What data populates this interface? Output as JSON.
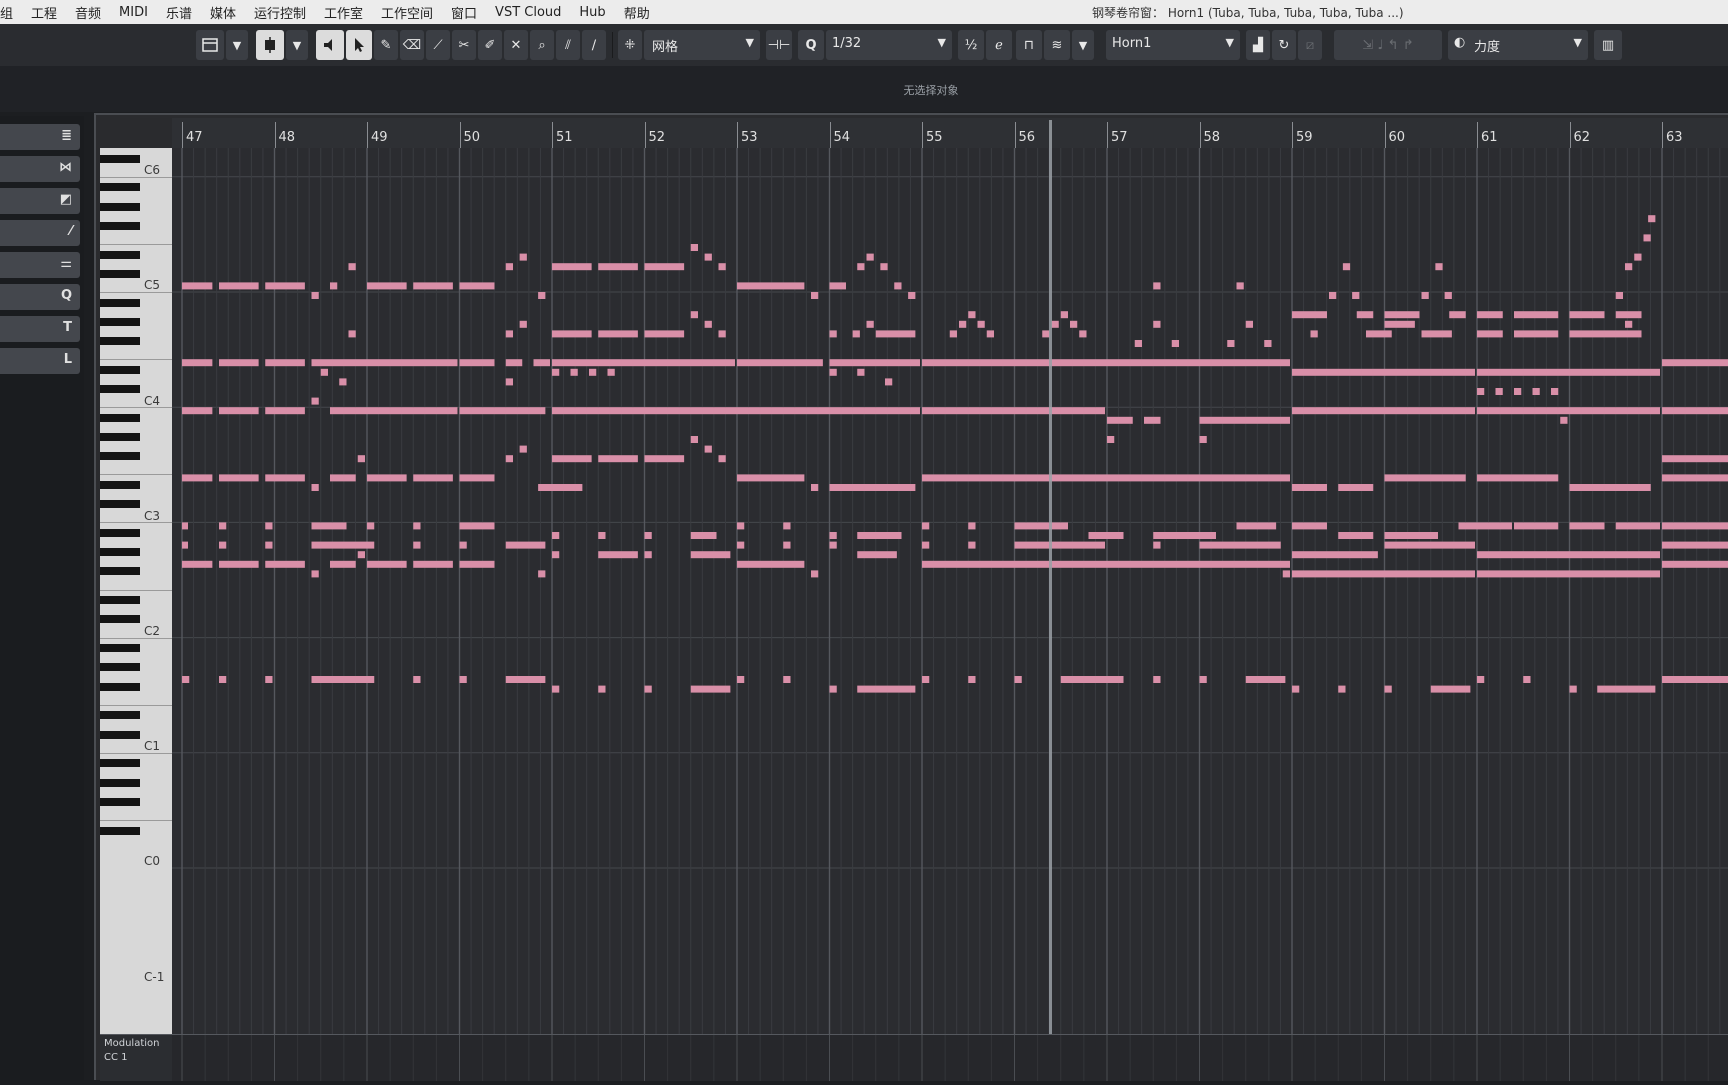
{
  "menu": [
    "组",
    "工程",
    "音频",
    "MIDI",
    "乐谱",
    "媒体",
    "运行控制",
    "工作室",
    "工作空间",
    "窗口",
    "VST Cloud",
    "Hub",
    "帮助"
  ],
  "window_title": "钢琴卷帘窗： Horn1 (Tuba, Tuba, Tuba, Tuba, Tuba ...)",
  "toolbar": {
    "snap_type": "网格",
    "quantize": "1/32",
    "track": "Horn1",
    "controller": "力度"
  },
  "status_text": "无选择对象",
  "ruler": {
    "bars": [
      "47",
      "48",
      "49",
      "50",
      "51",
      "52",
      "53",
      "54",
      "55",
      "56",
      "57",
      "58",
      "59",
      "60",
      "61",
      "62",
      "63"
    ]
  },
  "keyboard": {
    "octave_labels": [
      "C6",
      "C5",
      "C4",
      "C3",
      "C2",
      "C1",
      "C0",
      "C-1"
    ]
  },
  "inspector": {
    "buttons": [
      "≣",
      "⋈",
      "◩",
      "⁄",
      "⚌",
      "Q",
      "T",
      "L"
    ]
  },
  "lane": {
    "name": "Modulation",
    "cc": "CC 1"
  },
  "colors": {
    "note": "#d98fa8",
    "background": "#2b2c30",
    "grid_bar": "#55585e",
    "grid_beat": "#3a3c40"
  },
  "notes": [
    {
      "bar": 47.0,
      "len": 0.35,
      "pitch": 72
    },
    {
      "bar": 47.4,
      "len": 0.45,
      "pitch": 72
    },
    {
      "bar": 47.9,
      "len": 0.45,
      "pitch": 72
    },
    {
      "bar": 48.4,
      "len": 0.1,
      "pitch": 71
    },
    {
      "bar": 48.6,
      "len": 0.1,
      "pitch": 72
    },
    {
      "bar": 48.8,
      "len": 0.1,
      "pitch": 74
    },
    {
      "bar": 49.0,
      "len": 0.45,
      "pitch": 72
    },
    {
      "bar": 49.5,
      "len": 0.45,
      "pitch": 72
    },
    {
      "bar": 50.0,
      "len": 0.4,
      "pitch": 72
    },
    {
      "bar": 50.5,
      "len": 0.1,
      "pitch": 74
    },
    {
      "bar": 50.65,
      "len": 0.1,
      "pitch": 75
    },
    {
      "bar": 50.85,
      "len": 0.1,
      "pitch": 71
    },
    {
      "bar": 51.0,
      "len": 0.45,
      "pitch": 74
    },
    {
      "bar": 51.5,
      "len": 0.45,
      "pitch": 74
    },
    {
      "bar": 52.0,
      "len": 0.45,
      "pitch": 74
    },
    {
      "bar": 52.5,
      "len": 0.1,
      "pitch": 76
    },
    {
      "bar": 52.65,
      "len": 0.1,
      "pitch": 75
    },
    {
      "bar": 52.8,
      "len": 0.1,
      "pitch": 74
    },
    {
      "bar": 53.0,
      "len": 0.75,
      "pitch": 72
    },
    {
      "bar": 53.8,
      "len": 0.1,
      "pitch": 71
    },
    {
      "bar": 54.0,
      "len": 0.2,
      "pitch": 72
    },
    {
      "bar": 54.3,
      "len": 0.1,
      "pitch": 74
    },
    {
      "bar": 54.4,
      "len": 0.1,
      "pitch": 75
    },
    {
      "bar": 54.55,
      "len": 0.1,
      "pitch": 74
    },
    {
      "bar": 54.7,
      "len": 0.1,
      "pitch": 72
    },
    {
      "bar": 54.85,
      "len": 0.1,
      "pitch": 71
    },
    {
      "bar": 57.5,
      "len": 0.1,
      "pitch": 72
    },
    {
      "bar": 58.4,
      "len": 0.1,
      "pitch": 72
    },
    {
      "bar": 59.4,
      "len": 0.1,
      "pitch": 71
    },
    {
      "bar": 59.55,
      "len": 0.1,
      "pitch": 74
    },
    {
      "bar": 59.65,
      "len": 0.1,
      "pitch": 71
    },
    {
      "bar": 60.4,
      "len": 0.1,
      "pitch": 71
    },
    {
      "bar": 60.55,
      "len": 0.1,
      "pitch": 74
    },
    {
      "bar": 60.65,
      "len": 0.1,
      "pitch": 71
    },
    {
      "bar": 62.5,
      "len": 0.1,
      "pitch": 71
    },
    {
      "bar": 62.6,
      "len": 0.1,
      "pitch": 74
    },
    {
      "bar": 62.7,
      "len": 0.1,
      "pitch": 75
    },
    {
      "bar": 62.8,
      "len": 0.1,
      "pitch": 77
    },
    {
      "bar": 62.85,
      "len": 0.1,
      "pitch": 79
    },
    {
      "bar": 55.3,
      "len": 0.1,
      "pitch": 67
    },
    {
      "bar": 55.4,
      "len": 0.1,
      "pitch": 68
    },
    {
      "bar": 55.5,
      "len": 0.1,
      "pitch": 69
    },
    {
      "bar": 55.6,
      "len": 0.1,
      "pitch": 68
    },
    {
      "bar": 55.7,
      "len": 0.1,
      "pitch": 67
    },
    {
      "bar": 56.3,
      "len": 0.1,
      "pitch": 67
    },
    {
      "bar": 56.4,
      "len": 0.1,
      "pitch": 68
    },
    {
      "bar": 56.5,
      "len": 0.1,
      "pitch": 69
    },
    {
      "bar": 56.6,
      "len": 0.1,
      "pitch": 68
    },
    {
      "bar": 56.7,
      "len": 0.1,
      "pitch": 67
    },
    {
      "bar": 57.3,
      "len": 0.1,
      "pitch": 66
    },
    {
      "bar": 57.5,
      "len": 0.1,
      "pitch": 68
    },
    {
      "bar": 57.7,
      "len": 0.1,
      "pitch": 66
    },
    {
      "bar": 58.3,
      "len": 0.1,
      "pitch": 66
    },
    {
      "bar": 58.5,
      "len": 0.1,
      "pitch": 68
    },
    {
      "bar": 58.7,
      "len": 0.1,
      "pitch": 66
    },
    {
      "bar": 59.0,
      "len": 0.4,
      "pitch": 69
    },
    {
      "bar": 59.7,
      "len": 0.2,
      "pitch": 69
    },
    {
      "bar": 60.0,
      "len": 0.4,
      "pitch": 69
    },
    {
      "bar": 60.7,
      "len": 0.2,
      "pitch": 69
    },
    {
      "bar": 61.0,
      "len": 0.3,
      "pitch": 69
    },
    {
      "bar": 61.4,
      "len": 0.5,
      "pitch": 69
    },
    {
      "bar": 62.0,
      "len": 0.4,
      "pitch": 69
    },
    {
      "bar": 62.5,
      "len": 0.3,
      "pitch": 69
    },
    {
      "bar": 48.8,
      "len": 0.1,
      "pitch": 67
    },
    {
      "bar": 50.5,
      "len": 0.1,
      "pitch": 67
    },
    {
      "bar": 50.65,
      "len": 0.1,
      "pitch": 68
    },
    {
      "bar": 51.0,
      "len": 0.45,
      "pitch": 67
    },
    {
      "bar": 51.5,
      "len": 0.45,
      "pitch": 67
    },
    {
      "bar": 52.0,
      "len": 0.45,
      "pitch": 67
    },
    {
      "bar": 52.5,
      "len": 0.1,
      "pitch": 69
    },
    {
      "bar": 52.65,
      "len": 0.1,
      "pitch": 68
    },
    {
      "bar": 52.8,
      "len": 0.1,
      "pitch": 67
    },
    {
      "bar": 54.0,
      "len": 0.1,
      "pitch": 67
    },
    {
      "bar": 54.25,
      "len": 0.1,
      "pitch": 67
    },
    {
      "bar": 54.4,
      "len": 0.1,
      "pitch": 68
    },
    {
      "bar": 54.5,
      "len": 0.45,
      "pitch": 67
    },
    {
      "bar": 59.2,
      "len": 0.1,
      "pitch": 67
    },
    {
      "bar": 59.8,
      "len": 0.3,
      "pitch": 67
    },
    {
      "bar": 60.0,
      "len": 0.35,
      "pitch": 68
    },
    {
      "bar": 60.4,
      "len": 0.35,
      "pitch": 67
    },
    {
      "bar": 61.0,
      "len": 0.3,
      "pitch": 67
    },
    {
      "bar": 61.4,
      "len": 0.5,
      "pitch": 67
    },
    {
      "bar": 62.0,
      "len": 0.8,
      "pitch": 67
    },
    {
      "bar": 62.6,
      "len": 0.1,
      "pitch": 68
    },
    {
      "bar": 47.0,
      "len": 0.35,
      "pitch": 64
    },
    {
      "bar": 47.4,
      "len": 0.45,
      "pitch": 64
    },
    {
      "bar": 47.9,
      "len": 0.45,
      "pitch": 64
    },
    {
      "bar": 48.4,
      "len": 1.6,
      "pitch": 64
    },
    {
      "bar": 50.0,
      "len": 0.4,
      "pitch": 64
    },
    {
      "bar": 50.5,
      "len": 0.2,
      "pitch": 64
    },
    {
      "bar": 50.8,
      "len": 0.2,
      "pitch": 64
    },
    {
      "bar": 51.0,
      "len": 2.0,
      "pitch": 64
    },
    {
      "bar": 53.0,
      "len": 0.95,
      "pitch": 64
    },
    {
      "bar": 54.0,
      "len": 1.0,
      "pitch": 64
    },
    {
      "bar": 55.0,
      "len": 4.0,
      "pitch": 64
    },
    {
      "bar": 59.0,
      "len": 2.0,
      "pitch": 63
    },
    {
      "bar": 61.0,
      "len": 2.0,
      "pitch": 63
    },
    {
      "bar": 63.0,
      "len": 1.0,
      "pitch": 64
    },
    {
      "bar": 48.5,
      "len": 0.1,
      "pitch": 63
    },
    {
      "bar": 48.7,
      "len": 0.1,
      "pitch": 62
    },
    {
      "bar": 50.5,
      "len": 0.1,
      "pitch": 62
    },
    {
      "bar": 51.0,
      "len": 0.1,
      "pitch": 63
    },
    {
      "bar": 51.2,
      "len": 0.1,
      "pitch": 63
    },
    {
      "bar": 51.4,
      "len": 0.1,
      "pitch": 63
    },
    {
      "bar": 51.6,
      "len": 0.1,
      "pitch": 63
    },
    {
      "bar": 54.0,
      "len": 0.1,
      "pitch": 63
    },
    {
      "bar": 54.3,
      "len": 0.1,
      "pitch": 63
    },
    {
      "bar": 54.6,
      "len": 0.1,
      "pitch": 62
    },
    {
      "bar": 61.0,
      "len": 0.1,
      "pitch": 61
    },
    {
      "bar": 61.2,
      "len": 0.1,
      "pitch": 61
    },
    {
      "bar": 61.4,
      "len": 0.1,
      "pitch": 61
    },
    {
      "bar": 61.6,
      "len": 0.1,
      "pitch": 61
    },
    {
      "bar": 61.8,
      "len": 0.1,
      "pitch": 61
    },
    {
      "bar": 47.0,
      "len": 0.35,
      "pitch": 59
    },
    {
      "bar": 47.4,
      "len": 0.45,
      "pitch": 59
    },
    {
      "bar": 47.9,
      "len": 0.45,
      "pitch": 59
    },
    {
      "bar": 48.4,
      "len": 0.1,
      "pitch": 60
    },
    {
      "bar": 48.6,
      "len": 1.4,
      "pitch": 59
    },
    {
      "bar": 50.0,
      "len": 0.95,
      "pitch": 59
    },
    {
      "bar": 51.0,
      "len": 4.0,
      "pitch": 59
    },
    {
      "bar": 55.0,
      "len": 2.0,
      "pitch": 59
    },
    {
      "bar": 57.0,
      "len": 0.3,
      "pitch": 58
    },
    {
      "bar": 57.4,
      "len": 0.2,
      "pitch": 58
    },
    {
      "bar": 58.0,
      "len": 1.0,
      "pitch": 58
    },
    {
      "bar": 59.0,
      "len": 2.0,
      "pitch": 59
    },
    {
      "bar": 61.0,
      "len": 2.0,
      "pitch": 59
    },
    {
      "bar": 63.0,
      "len": 1.0,
      "pitch": 59
    },
    {
      "bar": 57.0,
      "len": 0.1,
      "pitch": 56
    },
    {
      "bar": 58.0,
      "len": 0.1,
      "pitch": 56
    },
    {
      "bar": 61.9,
      "len": 0.1,
      "pitch": 58
    },
    {
      "bar": 47.0,
      "len": 0.35,
      "pitch": 52
    },
    {
      "bar": 47.4,
      "len": 0.45,
      "pitch": 52
    },
    {
      "bar": 47.9,
      "len": 0.45,
      "pitch": 52
    },
    {
      "bar": 48.4,
      "len": 0.1,
      "pitch": 51
    },
    {
      "bar": 48.6,
      "len": 0.3,
      "pitch": 52
    },
    {
      "bar": 48.9,
      "len": 0.1,
      "pitch": 54
    },
    {
      "bar": 49.0,
      "len": 0.45,
      "pitch": 52
    },
    {
      "bar": 49.5,
      "len": 0.45,
      "pitch": 52
    },
    {
      "bar": 50.0,
      "len": 0.4,
      "pitch": 52
    },
    {
      "bar": 50.5,
      "len": 0.1,
      "pitch": 54
    },
    {
      "bar": 50.65,
      "len": 0.1,
      "pitch": 55
    },
    {
      "bar": 50.85,
      "len": 0.5,
      "pitch": 51
    },
    {
      "bar": 51.0,
      "len": 0.45,
      "pitch": 54
    },
    {
      "bar": 51.5,
      "len": 0.45,
      "pitch": 54
    },
    {
      "bar": 52.0,
      "len": 0.45,
      "pitch": 54
    },
    {
      "bar": 52.5,
      "len": 0.1,
      "pitch": 56
    },
    {
      "bar": 52.65,
      "len": 0.1,
      "pitch": 55
    },
    {
      "bar": 52.8,
      "len": 0.1,
      "pitch": 54
    },
    {
      "bar": 53.0,
      "len": 0.75,
      "pitch": 52
    },
    {
      "bar": 53.8,
      "len": 0.1,
      "pitch": 51
    },
    {
      "bar": 54.0,
      "len": 0.95,
      "pitch": 51
    },
    {
      "bar": 55.0,
      "len": 4.0,
      "pitch": 52
    },
    {
      "bar": 59.0,
      "len": 0.4,
      "pitch": 51
    },
    {
      "bar": 59.5,
      "len": 0.4,
      "pitch": 51
    },
    {
      "bar": 60.0,
      "len": 0.9,
      "pitch": 52
    },
    {
      "bar": 61.0,
      "len": 0.9,
      "pitch": 52
    },
    {
      "bar": 62.0,
      "len": 0.9,
      "pitch": 51
    },
    {
      "bar": 63.0,
      "len": 1.0,
      "pitch": 52
    },
    {
      "bar": 63.0,
      "len": 1.0,
      "pitch": 54
    },
    {
      "bar": 47.0,
      "len": 0.05,
      "pitch": 47
    },
    {
      "bar": 47.4,
      "len": 0.1,
      "pitch": 47
    },
    {
      "bar": 47.9,
      "len": 0.1,
      "pitch": 47
    },
    {
      "bar": 48.4,
      "len": 0.4,
      "pitch": 47
    },
    {
      "bar": 49.0,
      "len": 0.1,
      "pitch": 47
    },
    {
      "bar": 49.5,
      "len": 0.1,
      "pitch": 47
    },
    {
      "bar": 50.0,
      "len": 0.4,
      "pitch": 47
    },
    {
      "bar": 51.0,
      "len": 0.1,
      "pitch": 46
    },
    {
      "bar": 51.5,
      "len": 0.1,
      "pitch": 46
    },
    {
      "bar": 52.0,
      "len": 0.1,
      "pitch": 46
    },
    {
      "bar": 52.5,
      "len": 0.3,
      "pitch": 46
    },
    {
      "bar": 53.0,
      "len": 0.1,
      "pitch": 47
    },
    {
      "bar": 53.5,
      "len": 0.1,
      "pitch": 47
    },
    {
      "bar": 54.0,
      "len": 0.1,
      "pitch": 46
    },
    {
      "bar": 54.3,
      "len": 0.5,
      "pitch": 46
    },
    {
      "bar": 55.0,
      "len": 0.1,
      "pitch": 47
    },
    {
      "bar": 55.5,
      "len": 0.1,
      "pitch": 47
    },
    {
      "bar": 56.0,
      "len": 0.6,
      "pitch": 47
    },
    {
      "bar": 56.8,
      "len": 0.4,
      "pitch": 46
    },
    {
      "bar": 57.5,
      "len": 0.7,
      "pitch": 46
    },
    {
      "bar": 58.4,
      "len": 0.45,
      "pitch": 47
    },
    {
      "bar": 59.0,
      "len": 0.4,
      "pitch": 47
    },
    {
      "bar": 59.5,
      "len": 0.4,
      "pitch": 46
    },
    {
      "bar": 60.0,
      "len": 0.6,
      "pitch": 46
    },
    {
      "bar": 60.8,
      "len": 0.6,
      "pitch": 47
    },
    {
      "bar": 61.4,
      "len": 0.5,
      "pitch": 47
    },
    {
      "bar": 62.0,
      "len": 0.4,
      "pitch": 47
    },
    {
      "bar": 62.5,
      "len": 0.5,
      "pitch": 47
    },
    {
      "bar": 63.0,
      "len": 1.0,
      "pitch": 47
    },
    {
      "bar": 47.0,
      "len": 0.05,
      "pitch": 45
    },
    {
      "bar": 47.4,
      "len": 0.1,
      "pitch": 45
    },
    {
      "bar": 47.9,
      "len": 0.1,
      "pitch": 45
    },
    {
      "bar": 48.4,
      "len": 0.7,
      "pitch": 45
    },
    {
      "bar": 49.5,
      "len": 0.1,
      "pitch": 45
    },
    {
      "bar": 50.0,
      "len": 0.1,
      "pitch": 45
    },
    {
      "bar": 50.5,
      "len": 0.45,
      "pitch": 45
    },
    {
      "bar": 51.0,
      "len": 0.1,
      "pitch": 44
    },
    {
      "bar": 51.5,
      "len": 0.45,
      "pitch": 44
    },
    {
      "bar": 52.0,
      "len": 0.1,
      "pitch": 44
    },
    {
      "bar": 52.5,
      "len": 0.45,
      "pitch": 44
    },
    {
      "bar": 53.0,
      "len": 0.1,
      "pitch": 45
    },
    {
      "bar": 53.5,
      "len": 0.1,
      "pitch": 45
    },
    {
      "bar": 54.0,
      "len": 0.1,
      "pitch": 45
    },
    {
      "bar": 54.3,
      "len": 0.45,
      "pitch": 44
    },
    {
      "bar": 55.0,
      "len": 0.1,
      "pitch": 45
    },
    {
      "bar": 55.5,
      "len": 0.1,
      "pitch": 45
    },
    {
      "bar": 56.0,
      "len": 1.0,
      "pitch": 45
    },
    {
      "bar": 57.5,
      "len": 0.1,
      "pitch": 45
    },
    {
      "bar": 58.0,
      "len": 0.9,
      "pitch": 45
    },
    {
      "bar": 59.0,
      "len": 0.95,
      "pitch": 44
    },
    {
      "bar": 60.0,
      "len": 1.0,
      "pitch": 45
    },
    {
      "bar": 61.0,
      "len": 2.0,
      "pitch": 44
    },
    {
      "bar": 63.0,
      "len": 1.0,
      "pitch": 45
    },
    {
      "bar": 47.0,
      "len": 0.35,
      "pitch": 43
    },
    {
      "bar": 47.4,
      "len": 0.45,
      "pitch": 43
    },
    {
      "bar": 47.9,
      "len": 0.45,
      "pitch": 43
    },
    {
      "bar": 48.4,
      "len": 0.1,
      "pitch": 42
    },
    {
      "bar": 48.6,
      "len": 0.3,
      "pitch": 43
    },
    {
      "bar": 48.9,
      "len": 0.1,
      "pitch": 44
    },
    {
      "bar": 49.0,
      "len": 0.45,
      "pitch": 43
    },
    {
      "bar": 49.5,
      "len": 0.45,
      "pitch": 43
    },
    {
      "bar": 50.0,
      "len": 0.4,
      "pitch": 43
    },
    {
      "bar": 50.85,
      "len": 0.1,
      "pitch": 42
    },
    {
      "bar": 53.0,
      "len": 0.75,
      "pitch": 43
    },
    {
      "bar": 53.8,
      "len": 0.1,
      "pitch": 42
    },
    {
      "bar": 55.0,
      "len": 4.0,
      "pitch": 43
    },
    {
      "bar": 58.9,
      "len": 0.1,
      "pitch": 42
    },
    {
      "bar": 59.0,
      "len": 2.0,
      "pitch": 42
    },
    {
      "bar": 61.0,
      "len": 2.0,
      "pitch": 42
    },
    {
      "bar": 63.0,
      "len": 1.0,
      "pitch": 43
    },
    {
      "bar": 47.0,
      "len": 0.1,
      "pitch": 31
    },
    {
      "bar": 47.4,
      "len": 0.1,
      "pitch": 31
    },
    {
      "bar": 47.9,
      "len": 0.1,
      "pitch": 31
    },
    {
      "bar": 48.4,
      "len": 0.7,
      "pitch": 31
    },
    {
      "bar": 49.5,
      "len": 0.1,
      "pitch": 31
    },
    {
      "bar": 50.0,
      "len": 0.1,
      "pitch": 31
    },
    {
      "bar": 50.5,
      "len": 0.45,
      "pitch": 31
    },
    {
      "bar": 51.0,
      "len": 0.1,
      "pitch": 30
    },
    {
      "bar": 51.5,
      "len": 0.1,
      "pitch": 30
    },
    {
      "bar": 52.0,
      "len": 0.1,
      "pitch": 30
    },
    {
      "bar": 52.5,
      "len": 0.45,
      "pitch": 30
    },
    {
      "bar": 53.0,
      "len": 0.1,
      "pitch": 31
    },
    {
      "bar": 53.5,
      "len": 0.1,
      "pitch": 31
    },
    {
      "bar": 54.0,
      "len": 0.1,
      "pitch": 30
    },
    {
      "bar": 54.3,
      "len": 0.65,
      "pitch": 30
    },
    {
      "bar": 55.0,
      "len": 0.1,
      "pitch": 31
    },
    {
      "bar": 55.5,
      "len": 0.1,
      "pitch": 31
    },
    {
      "bar": 56.0,
      "len": 0.1,
      "pitch": 31
    },
    {
      "bar": 56.5,
      "len": 0.7,
      "pitch": 31
    },
    {
      "bar": 57.5,
      "len": 0.1,
      "pitch": 31
    },
    {
      "bar": 58.0,
      "len": 0.1,
      "pitch": 31
    },
    {
      "bar": 58.5,
      "len": 0.45,
      "pitch": 31
    },
    {
      "bar": 59.0,
      "len": 0.1,
      "pitch": 30
    },
    {
      "bar": 59.5,
      "len": 0.1,
      "pitch": 30
    },
    {
      "bar": 60.0,
      "len": 0.1,
      "pitch": 30
    },
    {
      "bar": 60.5,
      "len": 0.45,
      "pitch": 30
    },
    {
      "bar": 61.0,
      "len": 0.1,
      "pitch": 31
    },
    {
      "bar": 61.5,
      "len": 0.1,
      "pitch": 31
    },
    {
      "bar": 62.0,
      "len": 0.1,
      "pitch": 30
    },
    {
      "bar": 62.3,
      "len": 0.65,
      "pitch": 30
    },
    {
      "bar": 63.0,
      "len": 1.0,
      "pitch": 31
    }
  ]
}
